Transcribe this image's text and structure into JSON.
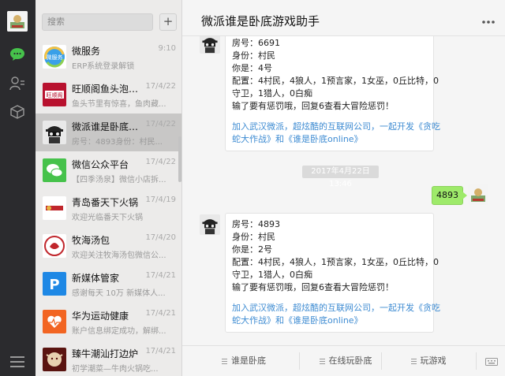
{
  "search": {
    "placeholder": "搜索"
  },
  "sessions": [
    {
      "name": "微服务",
      "time": "9:10",
      "msg": "ERP系统登录解锁"
    },
    {
      "name": "旺顺阁鱼头泡饼青...",
      "time": "17/4/22",
      "msg": "鱼头节里有惊喜，鱼肉藏..."
    },
    {
      "name": "微派谁是卧底游戏...",
      "time": "17/4/22",
      "msg": "房号：4893身份：村民..."
    },
    {
      "name": "微信公众平台",
      "time": "17/4/22",
      "msg": "【四季汤泉】微信小店拆..."
    },
    {
      "name": "青岛番天下火锅",
      "time": "17/4/19",
      "msg": "欢迎光临番天下火锅"
    },
    {
      "name": "牧海汤包",
      "time": "17/4/20",
      "msg": "欢迎关注牧海汤包微信公..."
    },
    {
      "name": "新媒体管家",
      "time": "17/4/21",
      "msg": "感谢每天 10万 新媒体人..."
    },
    {
      "name": "华为运动健康",
      "time": "17/4/21",
      "msg": "账户信息绑定成功，解绑..."
    },
    {
      "name": "臻牛潮汕打边炉",
      "time": "17/4/21",
      "msg": "初学潮菜—牛肉火锅吃..."
    }
  ],
  "chat": {
    "title": "微派谁是卧底游戏助手",
    "msg1": {
      "lines": [
        "房号：6691",
        "身份：村民",
        "你是：4号",
        "配置：4村民，4狼人，1预言家，1女巫，0丘比特，0",
        "守卫，1猎人，0白痴",
        "输了要有惩罚哦，回复6查看大冒险惩罚！"
      ],
      "links": [
        "加入武汉微派，超炫酷的互联网公司，一起开发《贪吃",
        "蛇大作战》和《谁是卧底online》"
      ]
    },
    "time_divider": "2017年4月22日 13:46",
    "sent": "4893",
    "msg2": {
      "lines": [
        "房号：4893",
        "身份：村民",
        "你是：2号",
        "配置：4村民，4狼人，1预言家，1女巫，0丘比特，0",
        "守卫，1猎人，0白痴",
        "输了要有惩罚哦，回复6查看大冒险惩罚！"
      ],
      "links": [
        "加入武汉微派，超炫酷的互联网公司，一起开发《贪吃",
        "蛇大作战》和《谁是卧底online》"
      ]
    },
    "menu": [
      "谁是卧底",
      "在线玩卧底",
      "玩游戏"
    ]
  },
  "colors": {
    "accent_green": "#46c24b",
    "link": "#3d8bd2",
    "sent_bubble": "#9eea6a"
  }
}
